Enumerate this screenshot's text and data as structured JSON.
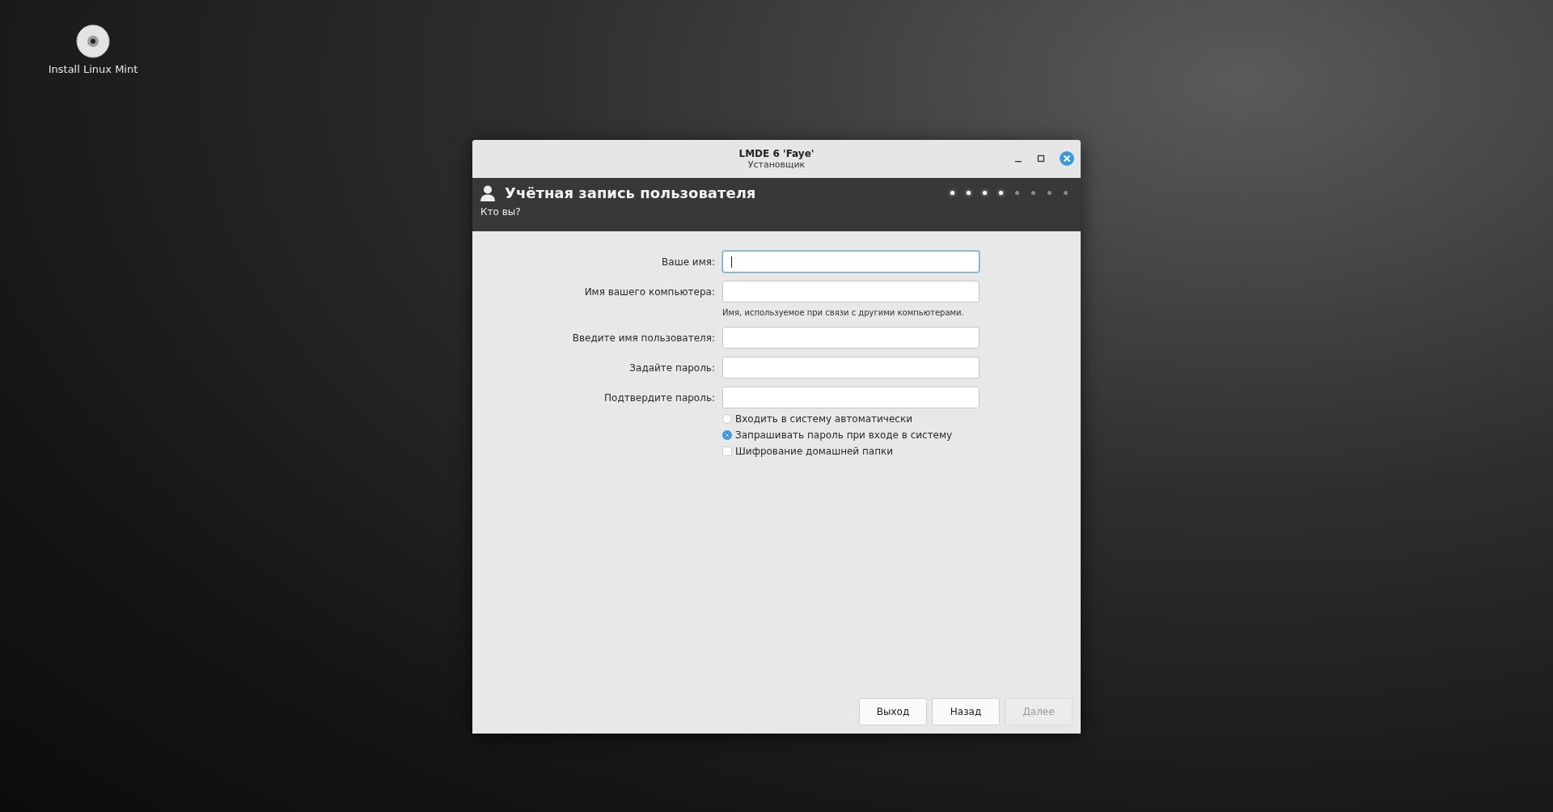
{
  "desktop_icons": [
    {
      "label": "Install Linux Mint"
    }
  ],
  "window": {
    "title": "LMDE 6 'Faye'",
    "subtitle": "Установщик"
  },
  "header": {
    "title": "Учётная запись пользователя",
    "subtitle": "Кто вы?",
    "steps": [
      {
        "done": true
      },
      {
        "done": true
      },
      {
        "done": true
      },
      {
        "done": true
      },
      {
        "done": false
      },
      {
        "done": false
      },
      {
        "done": false
      },
      {
        "done": false
      }
    ]
  },
  "fields": [
    {
      "label": "Ваше имя:",
      "focused": true
    },
    {
      "label": "Имя вашего компьютера:",
      "focused": false,
      "hint": "Имя, используемое при связи с другими компьютерами."
    },
    {
      "label": "Введите имя пользователя:",
      "focused": false
    },
    {
      "label": "Задайте пароль:",
      "focused": false
    },
    {
      "label": "Подтвердите пароль:",
      "focused": false
    }
  ],
  "options": [
    {
      "kind": "radio",
      "label": "Входить в систему автоматически",
      "selected": false
    },
    {
      "kind": "radio",
      "label": "Запрашивать пароль при входе в систему",
      "selected": true
    },
    {
      "kind": "checkbox",
      "label": "Шифрование домашней папки",
      "checked": false
    }
  ],
  "buttons": [
    {
      "label": "Выход",
      "disabled": false
    },
    {
      "label": "Назад",
      "disabled": false
    },
    {
      "label": "Далее",
      "disabled": true
    }
  ]
}
